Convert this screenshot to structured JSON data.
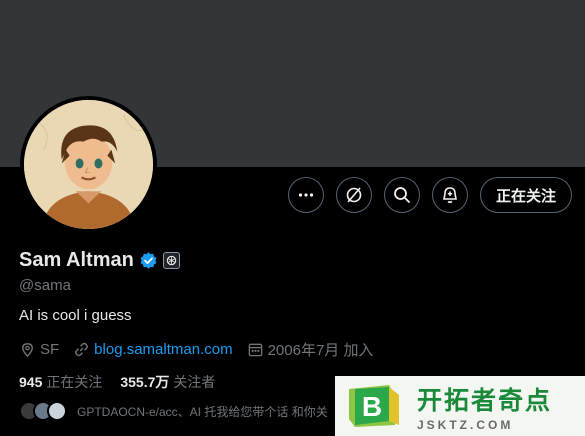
{
  "profile": {
    "name": "Sam Altman",
    "handle": "@sama",
    "bio": "AI is cool i guess",
    "location": "SF",
    "website": "blog.samaltman.com",
    "joined": "2006年7月 加入"
  },
  "stats": {
    "following_count": "945",
    "following_label": "正在关注",
    "followers_count": "355.7万",
    "followers_label": "关注者"
  },
  "followed_by": {
    "text": "GPTDAOCN-e/acc、AI 托我给您带个话 和你关"
  },
  "actions": {
    "more_icon": "more-icon",
    "grok_icon": "grok-icon",
    "search_icon": "search-icon",
    "notify_icon": "bell-plus-icon",
    "follow_label": "正在关注"
  },
  "watermark": {
    "title": "开拓者奇点",
    "subtitle": "JSKTZ.COM",
    "letter": "B"
  },
  "colors": {
    "background": "#000000",
    "banner": "#333639",
    "accent": "#1d9bf0",
    "muted": "#71767b",
    "text": "#e7e9ea"
  }
}
